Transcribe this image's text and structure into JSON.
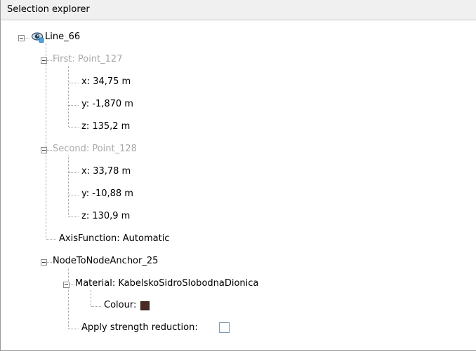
{
  "panel": {
    "title": "Selection explorer"
  },
  "tree": {
    "root": {
      "label": "Line_66",
      "icon": "eye-icon",
      "expanded": true
    },
    "first": {
      "label": "First: Point_127",
      "expanded": true,
      "disabled": true,
      "x": "x: 34,75 m",
      "y": "y: -1,870 m",
      "z": "z: 135,2 m"
    },
    "second": {
      "label": "Second: Point_128",
      "expanded": true,
      "disabled": true,
      "x": "x: 33,78 m",
      "y": "y: -10,88 m",
      "z": "z: 130,9 m"
    },
    "axis_function": "AxisFunction: Automatic",
    "anchor": {
      "label": "NodeToNodeAnchor_25",
      "expanded": true,
      "material": {
        "label": "Material: KabelskoSidroSlobodnaDionica",
        "expanded": true,
        "colour_label": "Colour:",
        "colour_value": "#4a2a24"
      },
      "strength_reduction": {
        "label": "Apply strength reduction:",
        "checked": false
      }
    }
  }
}
